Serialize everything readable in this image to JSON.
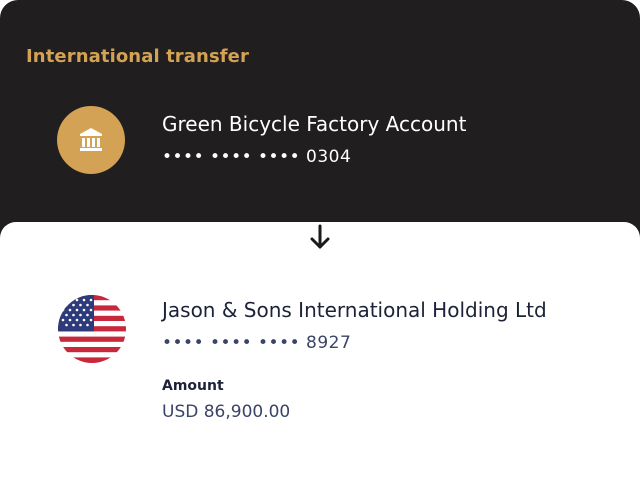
{
  "title": "International transfer",
  "colors": {
    "header_bg": "#201e1e",
    "accent": "#d4a255",
    "text_dark": "#1c2238",
    "text_muted": "#3a4466"
  },
  "source": {
    "icon": "bank-icon",
    "name": "Green Bicycle Factory Account",
    "account_number": "•••• •••• •••• 0304"
  },
  "transfer_direction_icon": "arrow-down-icon",
  "destination": {
    "icon": "us-flag-icon",
    "name": "Jason & Sons International Holding Ltd",
    "account_number": "•••• •••• •••• 8927",
    "amount_label": "Amount",
    "amount": "USD 86,900.00"
  }
}
